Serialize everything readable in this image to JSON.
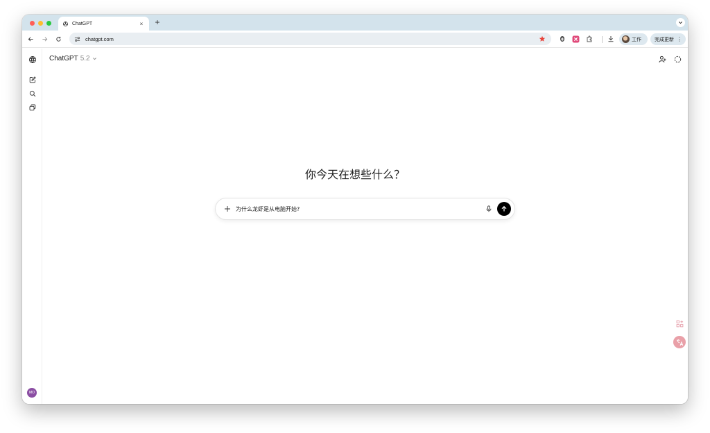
{
  "browser": {
    "tab_title": "ChatGPT",
    "tab_close": "×",
    "new_tab": "+",
    "url": "chatgpt.com",
    "profile_label": "工作",
    "update_label": "完成更新",
    "more": "⋮",
    "accent_star": "#e8453c"
  },
  "app": {
    "model_name": "ChatGPT",
    "model_version": "5.2",
    "greeting": "你今天在想些什么？",
    "composer_text": "为什么龙虾是从电脑开始?",
    "user_initials": "MO",
    "avatar_color": "#8b4ea3"
  }
}
